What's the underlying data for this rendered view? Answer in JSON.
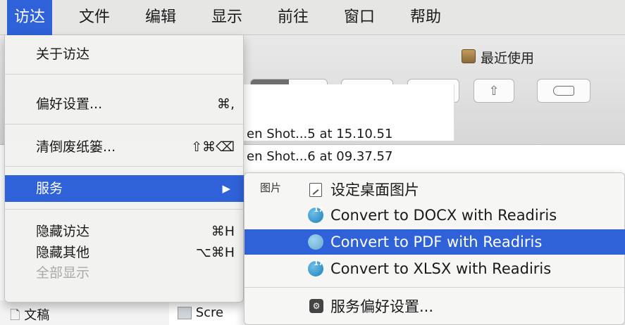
{
  "menubar": {
    "items": [
      "访达",
      "文件",
      "编辑",
      "显示",
      "前往",
      "窗口",
      "帮助"
    ]
  },
  "window": {
    "title": "最近使用",
    "files": [
      "en Shot...5 at 15.10.51",
      "en Shot...6 at 09.37.57"
    ],
    "sidebar_item": "文稿",
    "list_partial": "Scre"
  },
  "finder_menu": {
    "about": "关于访达",
    "preferences": "偏好设置...",
    "preferences_shortcut": "⌘,",
    "empty_trash": "清倒废纸篓...",
    "empty_trash_shortcut": "⇧⌘⌫",
    "services": "服务",
    "services_arrow": "▶",
    "hide": "隐藏访达",
    "hide_shortcut": "⌘H",
    "hide_others": "隐藏其他",
    "hide_others_shortcut": "⌥⌘H",
    "show_all": "全部显示"
  },
  "services_menu": {
    "group_label": "图片",
    "set_desktop": "设定桌面图片",
    "docx": "Convert to DOCX with Readiris",
    "pdf": "Convert to PDF with Readiris",
    "xlsx": "Convert to XLSX with Readiris",
    "preferences": "服务偏好设置..."
  },
  "colors": {
    "highlight": "#2f62d8"
  }
}
